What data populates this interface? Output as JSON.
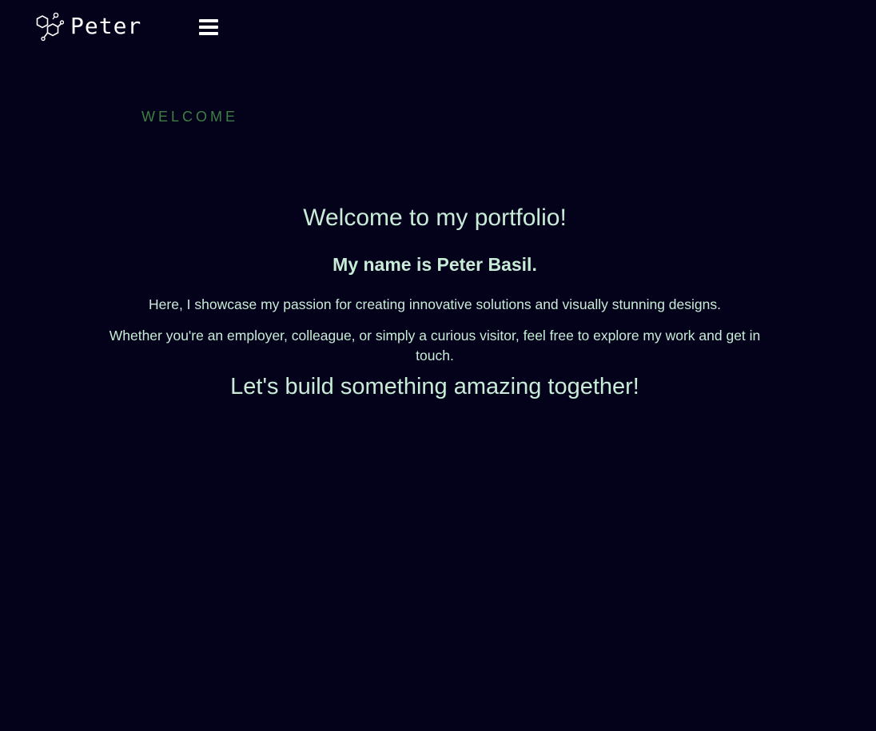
{
  "header": {
    "logo_text": "Peter",
    "logo_icon": "hexagon-molecule-icon",
    "menu_icon": "hamburger-menu-icon"
  },
  "hero": {
    "eyebrow": "WELCOME",
    "title": "Welcome to my portfolio!",
    "name_line": "My name is Peter Basil.",
    "paragraph_1": "Here, I showcase my passion for creating innovative solutions and visually stunning designs.",
    "paragraph_2": "Whether you're an employer, colleague, or simply a curious visitor, feel free to explore my work and get in touch.",
    "cta": "Let's build something amazing together!"
  },
  "colors": {
    "background": "#03021a",
    "text": "#c8ecd8",
    "eyebrow": "#3f7f45",
    "logo": "#ffffff"
  }
}
